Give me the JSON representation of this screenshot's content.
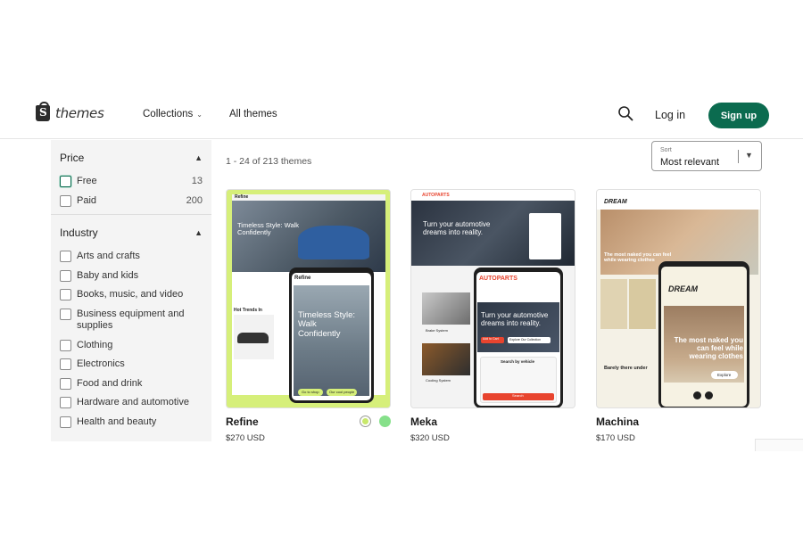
{
  "header": {
    "logo_text": "themes",
    "nav": {
      "collections": "Collections",
      "all_themes": "All themes"
    },
    "login": "Log in",
    "signup": "Sign up"
  },
  "sidebar": {
    "price": {
      "title": "Price",
      "options": [
        {
          "label": "Free",
          "count": "13"
        },
        {
          "label": "Paid",
          "count": "200"
        }
      ]
    },
    "industry": {
      "title": "Industry",
      "options": [
        "Arts and crafts",
        "Baby and kids",
        "Books, music, and video",
        "Business equipment and supplies",
        "Clothing",
        "Electronics",
        "Food and drink",
        "Hardware and automotive",
        "Health and beauty"
      ]
    }
  },
  "results": {
    "count_text": "1 - 24 of 213 themes"
  },
  "sort": {
    "label": "Sort",
    "value": "Most relevant"
  },
  "themes": [
    {
      "name": "Refine",
      "price": "$270 USD",
      "swatches": [
        "#c8e86a",
        "#86e08a"
      ],
      "preview": {
        "brand": "Refine",
        "hero": "Timeless Style: Walk Confidently",
        "section": "Hot Trends In",
        "cta_1": "Go to shop",
        "cta_2": "Our cool people"
      }
    },
    {
      "name": "Meka",
      "price": "$320 USD",
      "preview": {
        "brand": "AUTOPARTS",
        "hero": "Turn your automotive dreams into reality.",
        "search_title": "Search by vehicle",
        "search_btn": "Search",
        "item_1": "Brake System",
        "item_2": "Cooling System",
        "cta_1": "Add to Cart",
        "cta_2": "Explore Our Collection"
      }
    },
    {
      "name": "Machina",
      "price": "$170 USD",
      "preview": {
        "brand": "DREAM",
        "hero": "The most naked you can feel while wearing clothes",
        "hero_phone": "The most naked you can feel while wearing clothes",
        "sub": "Barely there under",
        "cta": "Explore"
      }
    }
  ]
}
